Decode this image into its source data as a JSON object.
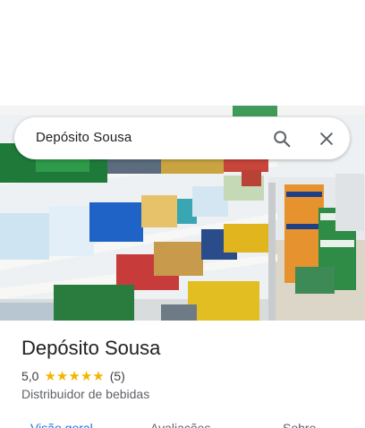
{
  "search": {
    "query": "Depósito Sousa",
    "search_icon": "search-icon",
    "close_icon": "close-icon"
  },
  "place": {
    "name": "Depósito Sousa",
    "rating": "5,0",
    "stars_filled": 5,
    "review_count": "(5)",
    "category": "Distribuidor de bebidas"
  },
  "tabs": [
    {
      "label": "Visão geral",
      "active": true
    },
    {
      "label": "Avaliações",
      "active": false
    },
    {
      "label": "Sobre",
      "active": false
    }
  ],
  "colors": {
    "accent": "#1a73e8",
    "star": "#f5b400",
    "text_primary": "#202124",
    "text_secondary": "#5f6368"
  }
}
